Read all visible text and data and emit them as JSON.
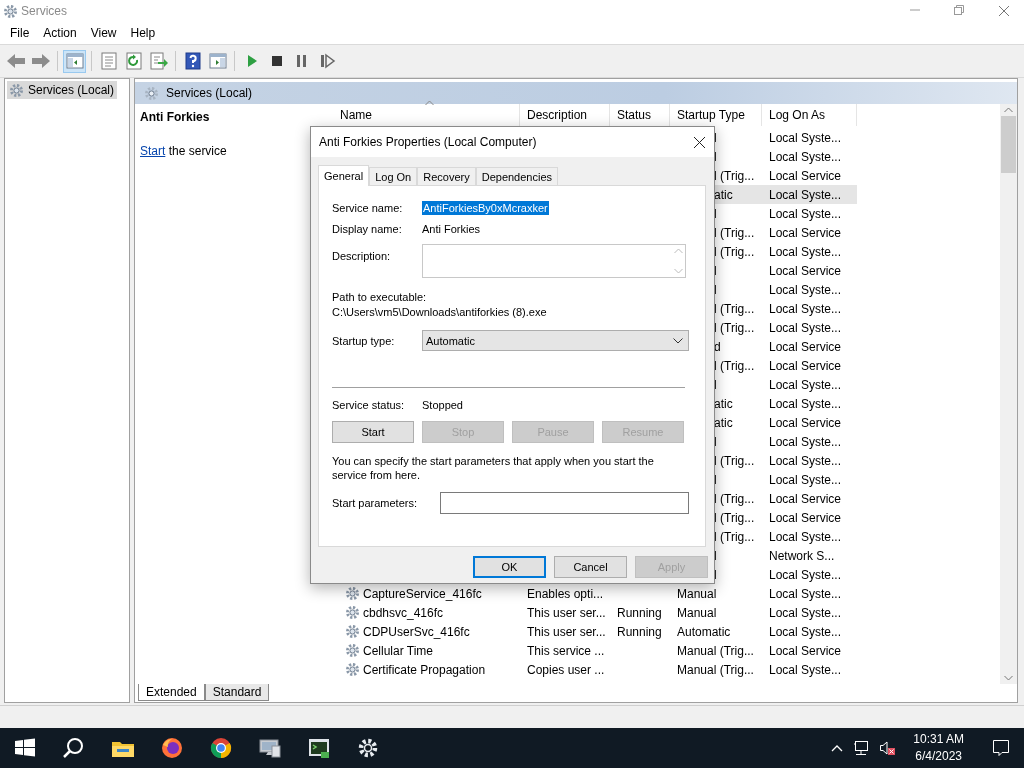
{
  "window": {
    "title": "Services"
  },
  "menu": [
    "File",
    "Action",
    "View",
    "Help"
  ],
  "toolbar": [
    [
      {
        "kind": "back",
        "selected": false
      },
      {
        "kind": "forward",
        "selected": false
      }
    ],
    [
      {
        "kind": "console-tree",
        "selected": true
      }
    ],
    [
      {
        "kind": "properties",
        "selected": false
      },
      {
        "kind": "refresh",
        "selected": false
      },
      {
        "kind": "export",
        "selected": false
      }
    ],
    [
      {
        "kind": "help",
        "selected": false
      },
      {
        "kind": "show-pane",
        "selected": false
      }
    ],
    [
      {
        "kind": "play",
        "selected": false
      },
      {
        "kind": "stop",
        "selected": false
      },
      {
        "kind": "pause",
        "selected": false
      },
      {
        "kind": "resume",
        "selected": false
      }
    ]
  ],
  "tree": [
    {
      "label": "Services (Local)",
      "selected": true
    }
  ],
  "pane_header": "Services (Local)",
  "details": {
    "title": "Anti Forkies",
    "link": "Start",
    "text": "the service"
  },
  "columns": [
    {
      "label": "Name",
      "sorted": true
    },
    {
      "label": "Description",
      "sorted": false
    },
    {
      "label": "Status",
      "sorted": false
    },
    {
      "label": "Startup Type",
      "sorted": false
    },
    {
      "label": "Log On As",
      "sorted": false
    }
  ],
  "rows": [
    {
      "kind": "covered",
      "startup_type": "l",
      "log_on_as": "Local Syste...",
      "selected": false
    },
    {
      "kind": "covered",
      "startup_type": "l",
      "log_on_as": "Local Syste...",
      "selected": false
    },
    {
      "kind": "covered",
      "startup_type": "l (Trig...",
      "log_on_as": "Local Service",
      "selected": false
    },
    {
      "kind": "covered",
      "startup_type": "atic",
      "log_on_as": "Local Syste...",
      "selected": true
    },
    {
      "kind": "covered",
      "startup_type": "l",
      "log_on_as": "Local Syste...",
      "selected": false
    },
    {
      "kind": "covered",
      "startup_type": "l (Trig...",
      "log_on_as": "Local Service",
      "selected": false
    },
    {
      "kind": "covered",
      "startup_type": "l (Trig...",
      "log_on_as": "Local Syste...",
      "selected": false
    },
    {
      "kind": "covered",
      "startup_type": "l",
      "log_on_as": "Local Service",
      "selected": false
    },
    {
      "kind": "covered",
      "startup_type": "l",
      "log_on_as": "Local Syste...",
      "selected": false
    },
    {
      "kind": "covered",
      "startup_type": "l (Trig...",
      "log_on_as": "Local Syste...",
      "selected": false
    },
    {
      "kind": "covered",
      "startup_type": "l (Trig...",
      "log_on_as": "Local Syste...",
      "selected": false
    },
    {
      "kind": "covered",
      "startup_type": "d",
      "log_on_as": "Local Service",
      "selected": false
    },
    {
      "kind": "covered",
      "startup_type": "l (Trig...",
      "log_on_as": "Local Service",
      "selected": false
    },
    {
      "kind": "covered",
      "startup_type": "l",
      "log_on_as": "Local Syste...",
      "selected": false
    },
    {
      "kind": "covered",
      "startup_type": "atic",
      "log_on_as": "Local Syste...",
      "selected": false
    },
    {
      "kind": "covered",
      "startup_type": "atic",
      "log_on_as": "Local Service",
      "selected": false
    },
    {
      "kind": "covered",
      "startup_type": "l",
      "log_on_as": "Local Syste...",
      "selected": false
    },
    {
      "kind": "covered",
      "startup_type": "l (Trig...",
      "log_on_as": "Local Syste...",
      "selected": false
    },
    {
      "kind": "covered",
      "startup_type": "l",
      "log_on_as": "Local Syste...",
      "selected": false
    },
    {
      "kind": "covered",
      "startup_type": "l (Trig...",
      "log_on_as": "Local Service",
      "selected": false
    },
    {
      "kind": "covered",
      "startup_type": "l (Trig...",
      "log_on_as": "Local Service",
      "selected": false
    },
    {
      "kind": "covered",
      "startup_type": "l (Trig...",
      "log_on_as": "Local Syste...",
      "selected": false
    },
    {
      "kind": "covered",
      "startup_type": "l",
      "log_on_as": "Network S...",
      "selected": false
    },
    {
      "kind": "covered",
      "startup_type": "l",
      "log_on_as": "Local Syste...",
      "selected": false
    },
    {
      "kind": "full",
      "name": "CaptureService_416fc",
      "description": "Enables opti...",
      "startup_type": "Manual",
      "log_on_as": "Local Syste...",
      "selected": false
    },
    {
      "kind": "full",
      "name": "cbdhsvc_416fc",
      "description": "This user ser...",
      "status": "Running",
      "startup_type": "Manual",
      "log_on_as": "Local Syste...",
      "selected": false
    },
    {
      "kind": "full",
      "name": "CDPUserSvc_416fc",
      "description": "This user ser...",
      "status": "Running",
      "startup_type": "Automatic",
      "log_on_as": "Local Syste...",
      "selected": false
    },
    {
      "kind": "full",
      "name": "Cellular Time",
      "description": "This service ...",
      "startup_type": "Manual (Trig...",
      "log_on_as": "Local Service",
      "selected": false
    },
    {
      "kind": "full",
      "name": "Certificate Propagation",
      "description": "Copies user ...",
      "startup_type": "Manual (Trig...",
      "log_on_as": "Local Syste...",
      "selected": false
    }
  ],
  "view_tabs": [
    {
      "label": "Extended",
      "selected": true
    },
    {
      "label": "Standard",
      "selected": false
    }
  ],
  "dialog": {
    "title": "Anti Forkies Properties (Local Computer)",
    "tabs": [
      {
        "label": "General",
        "selected": true
      },
      {
        "label": "Log On",
        "selected": false
      },
      {
        "label": "Recovery",
        "selected": false
      },
      {
        "label": "Dependencies",
        "selected": false
      }
    ],
    "service_name_label": "Service name:",
    "service_name": "AntiForkiesBy0xMcraxker",
    "display_name_label": "Display name:",
    "display_name": "Anti Forkies",
    "description_label": "Description:",
    "path_label": "Path to executable:",
    "path": "C:\\Users\\vm5\\Downloads\\antiforkies (8).exe",
    "startup_type_label": "Startup type:",
    "startup_type": "Automatic",
    "status_label": "Service status:",
    "status": "Stopped",
    "service_buttons": [
      {
        "label": "Start",
        "disabled": false
      },
      {
        "label": "Stop",
        "disabled": true
      },
      {
        "label": "Pause",
        "disabled": true
      },
      {
        "label": "Resume",
        "disabled": true
      }
    ],
    "hint": "You can specify the start parameters that apply when you start the service from here.",
    "parameters_label": "Start parameters:",
    "buttons": [
      {
        "label": "OK",
        "default": true,
        "disabled": false
      },
      {
        "label": "Cancel",
        "default": false,
        "disabled": false
      },
      {
        "label": "Apply",
        "default": false,
        "disabled": true
      }
    ]
  },
  "taskbar": {
    "apps": [
      {
        "kind": "start"
      },
      {
        "kind": "search"
      },
      {
        "kind": "explorer"
      },
      {
        "kind": "firefox"
      },
      {
        "kind": "chrome"
      },
      {
        "kind": "server"
      },
      {
        "kind": "terminal"
      },
      {
        "kind": "services"
      }
    ],
    "time": "10:31 AM",
    "date": "6/4/2023"
  }
}
